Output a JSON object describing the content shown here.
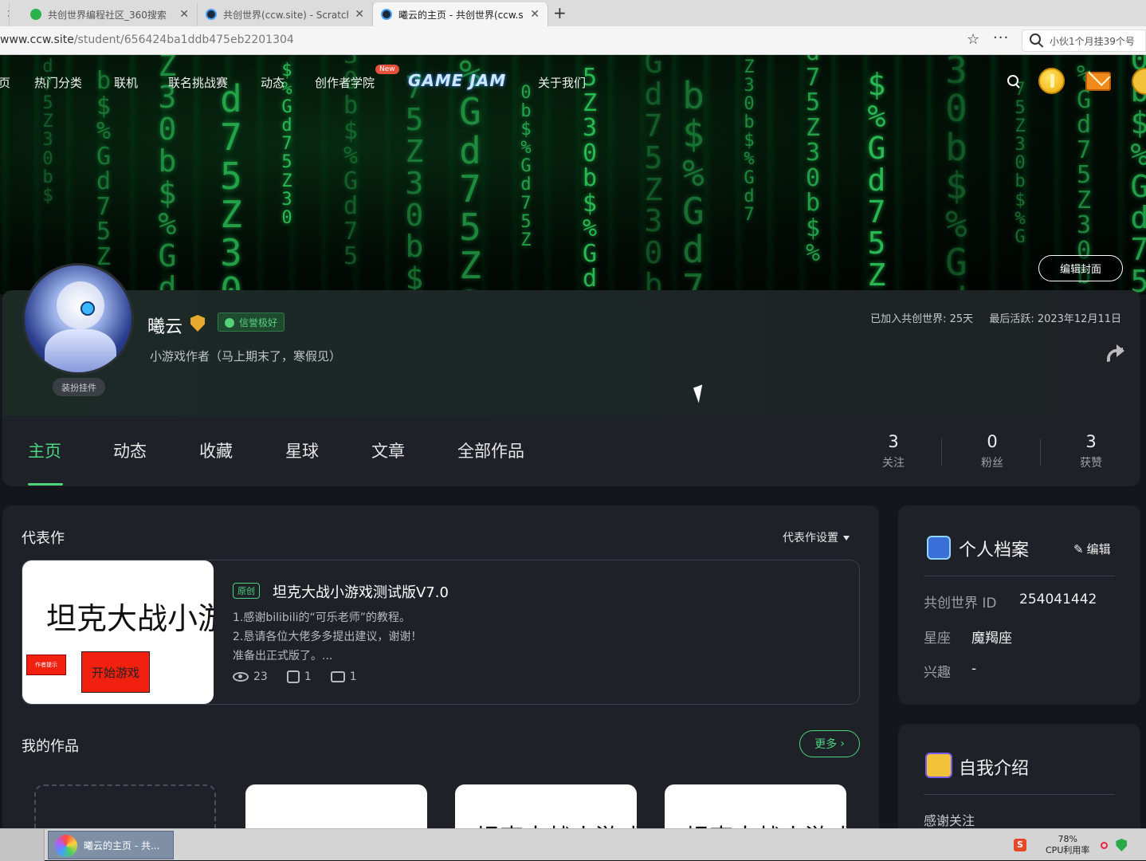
{
  "browser": {
    "tabs": [
      {
        "title": "共创世界编程社区_360搜索",
        "active": false
      },
      {
        "title": "共创世界(ccw.site) - Scratch",
        "active": false
      },
      {
        "title": "曦云的主页 - 共创世界(ccw.site)",
        "active": true
      }
    ],
    "url_host": "www.ccw.site",
    "url_path": "/student/656424ba1ddb475eb2201304",
    "search_text": "小伙1个月挂39个号"
  },
  "nav": {
    "items": [
      "页",
      "热门分类",
      "联机",
      "联名挑战赛",
      "动态",
      "创作者学院",
      "关于我们"
    ],
    "new_badge": "New",
    "gamejam": "GAME JAM"
  },
  "banner": {
    "edit_cover": "编辑封面",
    "matrix_chars": [
      "G",
      "b",
      "Z",
      "d",
      "$",
      "3",
      "7",
      "%",
      "0",
      "5"
    ]
  },
  "profile": {
    "username": "曦云",
    "credit": "信誉极好",
    "bio": "小游戏作者（马上期末了，寒假见）",
    "decor": "装扮挂件",
    "joined": "已加入共创世界: 25天",
    "last_active": "最后活跃: 2023年12月11日"
  },
  "profile_tabs": [
    "主页",
    "动态",
    "收藏",
    "星球",
    "文章",
    "全部作品"
  ],
  "stats": [
    {
      "num": "3",
      "label": "关注"
    },
    {
      "num": "0",
      "label": "粉丝"
    },
    {
      "num": "3",
      "label": "获赞"
    }
  ],
  "featured": {
    "section_title": "代表作",
    "setting": "代表作设置",
    "thumb_title": "坦克大战小游戏",
    "thumb_small": "作者提示",
    "thumb_button": "开始游戏",
    "badge": "原创",
    "title": "坦克大战小游戏测试版V7.0",
    "desc": [
      "1.感谢bilibili的“可乐老师”的教程。",
      "2.恳请各位大佬多多提出建议，谢谢！",
      "准备出正式版了。..."
    ],
    "views": "23",
    "likes": "1",
    "comments": "1"
  },
  "my_works": {
    "title": "我的作品",
    "more": "更多",
    "card_texts": [
      "",
      "坦克大战小游戏",
      "坦克大战小游戏"
    ]
  },
  "archive": {
    "title": "个人档案",
    "edit": "编辑",
    "id_label": "共创世界 ID",
    "id_value": "254041442",
    "zodiac_label": "星座",
    "zodiac_value": "魔羯座",
    "interest_label": "兴趣",
    "interest_value": "-"
  },
  "intro": {
    "title": "自我介绍",
    "text": "感谢关注"
  },
  "taskbar": {
    "app_label": "曦云的主页 - 共...",
    "cpu_percent": "78%",
    "cpu_label": "CPU利用率"
  }
}
